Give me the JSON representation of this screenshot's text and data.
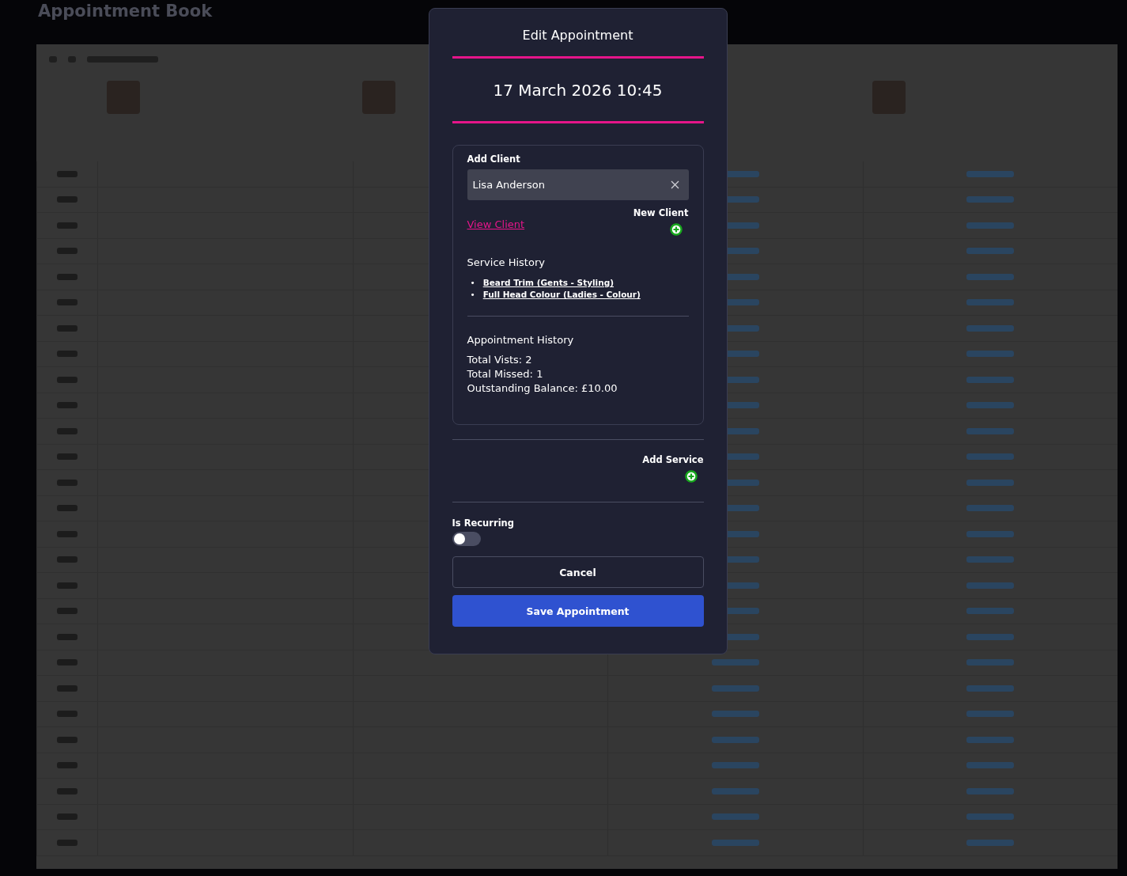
{
  "app_title": "Appointment Book",
  "modal": {
    "title": "Edit Appointment",
    "datetime": "17 March 2026 10:45",
    "client": {
      "label": "Add Client",
      "value": "Lisa Anderson",
      "new_client_label": "New Client",
      "view_client_link": "View Client",
      "service_history": {
        "title": "Service History",
        "items": [
          {
            "marker": "•",
            "label": "Beard Trim (Gents - Styling)"
          },
          {
            "marker": "•",
            "label": "Full Head Colour (Ladies - Colour)"
          }
        ]
      },
      "appointment_history": {
        "title": "Appointment History",
        "lines": [
          "Total Vists: 2",
          "Total Missed: 1",
          "Outstanding Balance: £10.00"
        ]
      }
    },
    "add_service_label": "Add Service",
    "recurring": {
      "label": "Is Recurring",
      "on": false
    },
    "buttons": [
      {
        "label": "Cancel",
        "kind": "secondary"
      },
      {
        "label": "Save Appointment",
        "kind": "primary"
      }
    ]
  }
}
